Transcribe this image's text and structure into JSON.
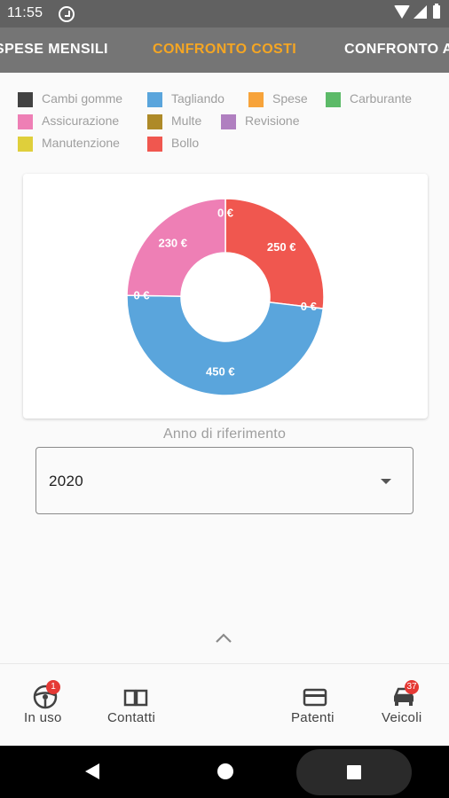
{
  "status_bar": {
    "time": "11:55"
  },
  "tabs": [
    {
      "label": "SPESE MENSILI",
      "active": false
    },
    {
      "label": "CONFRONTO COSTI",
      "active": true
    },
    {
      "label": "CONFRONTO ANNUALE",
      "active": false
    }
  ],
  "legend": [
    {
      "label": "Cambi gomme",
      "color": "#424242"
    },
    {
      "label": "Tagliando",
      "color": "#5aa5dc"
    },
    {
      "label": "Spese",
      "color": "#f7a33a"
    },
    {
      "label": "Carburante",
      "color": "#5cba68"
    },
    {
      "label": "Assicurazione",
      "color": "#ee7fb5"
    },
    {
      "label": "Multe",
      "color": "#ae8a28"
    },
    {
      "label": "Revisione",
      "color": "#b07fc0"
    },
    {
      "label": "Manutenzione",
      "color": "#dfcf3b"
    },
    {
      "label": "Bollo",
      "color": "#f0574f"
    }
  ],
  "chart_data": {
    "type": "pie",
    "style": "donut",
    "slices": [
      {
        "category": "Bollo",
        "value": 250,
        "label": "250 €",
        "color": "#f0574f"
      },
      {
        "category": "Carburante",
        "value": 0,
        "label": "0 €",
        "color": "#5cba68"
      },
      {
        "category": "Tagliando",
        "value": 450,
        "label": "450 €",
        "color": "#5aa5dc"
      },
      {
        "category": "Multe",
        "value": 0,
        "label": "0 €",
        "color": "#ae8a28"
      },
      {
        "category": "Assicurazione",
        "value": 230,
        "label": "230 €",
        "color": "#ee7fb5"
      },
      {
        "category": "Spese",
        "value": 0,
        "label": "0 €",
        "color": "#f7a33a"
      }
    ]
  },
  "year_field": {
    "label": "Anno di riferimento",
    "value": "2020"
  },
  "bottom_nav": [
    {
      "label": "In uso",
      "badge": "1",
      "icon": "steering-wheel-icon"
    },
    {
      "label": "Contatti",
      "icon": "book-icon"
    },
    {
      "label": "Patenti",
      "icon": "card-icon"
    },
    {
      "label": "Veicoli",
      "badge": "37",
      "icon": "car-icon"
    }
  ]
}
